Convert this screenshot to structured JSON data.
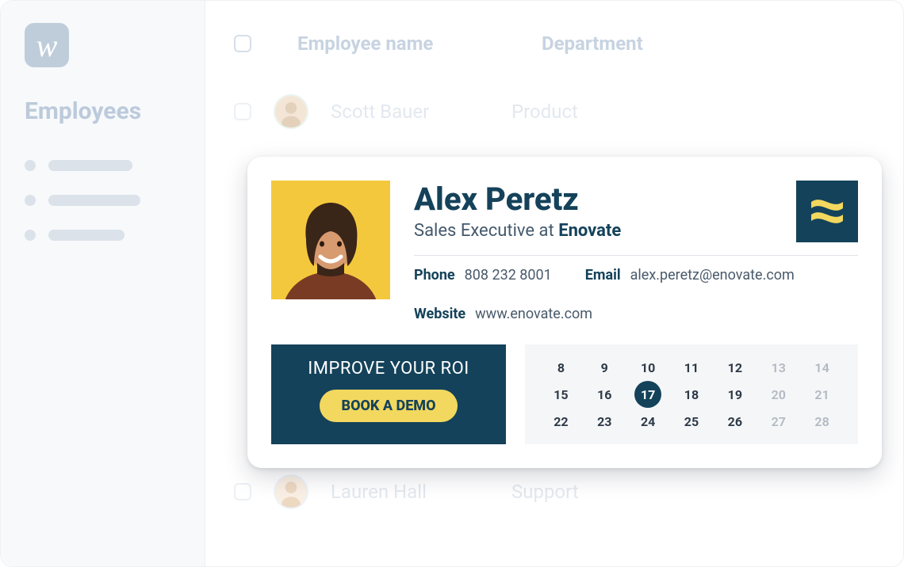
{
  "sidebar": {
    "logo_letter": "w",
    "title": "Employees"
  },
  "table": {
    "headers": {
      "name": "Employee name",
      "department": "Department"
    },
    "rows": [
      {
        "name": "Scott Bauer",
        "department": "Product"
      },
      {
        "name": "Lauren Hall",
        "department": "Support"
      }
    ]
  },
  "card": {
    "name": "Alex Peretz",
    "role": "Sales Executive at",
    "company": "Enovate",
    "phone_label": "Phone",
    "phone": "808 232 8001",
    "email_label": "Email",
    "email": "alex.peretz@enovate.com",
    "website_label": "Website",
    "website": "www.enovate.com",
    "cta_title": "IMPROVE YOUR ROI",
    "cta_button": "BOOK A DEMO",
    "calendar": {
      "days": [
        8,
        9,
        10,
        11,
        12,
        13,
        14,
        15,
        16,
        17,
        18,
        19,
        20,
        21,
        22,
        23,
        24,
        25,
        26,
        27,
        28
      ],
      "selected": 17,
      "muted": [
        13,
        14,
        20,
        21,
        27,
        28
      ]
    }
  }
}
